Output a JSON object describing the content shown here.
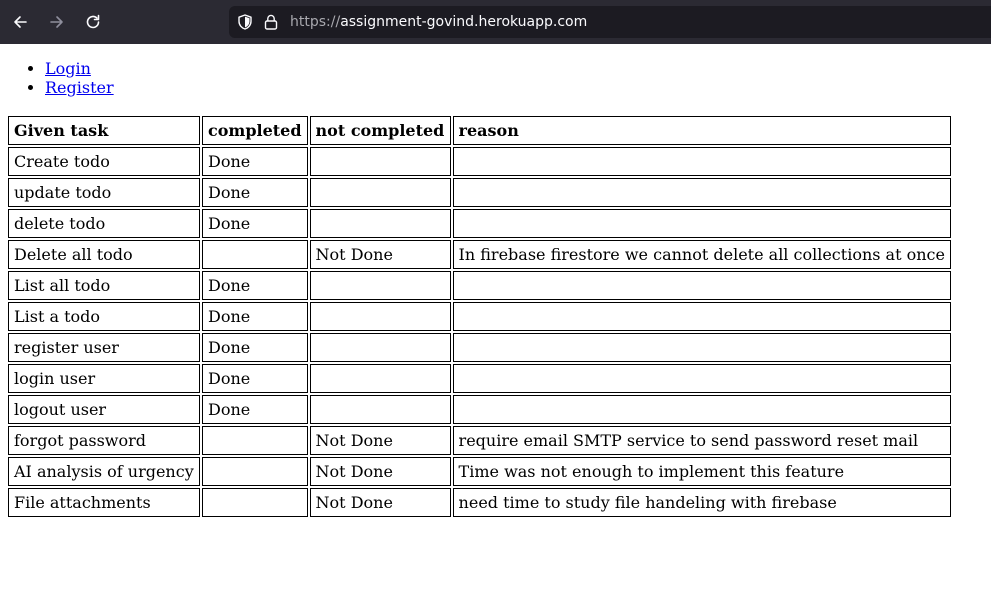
{
  "browser": {
    "url_scheme": "https://",
    "url_host": "assignment-govind.herokuapp.com",
    "back_icon": "arrow-left-icon",
    "forward_icon": "arrow-right-icon",
    "reload_icon": "reload-icon",
    "shield_icon": "shield-icon",
    "lock_icon": "lock-icon"
  },
  "nav": {
    "items": [
      {
        "label": "Login"
      },
      {
        "label": "Register"
      }
    ]
  },
  "table": {
    "headers": [
      "Given task",
      "completed",
      "not completed",
      "reason"
    ],
    "rows": [
      {
        "task": "Create todo",
        "completed": "Done",
        "not_completed": "",
        "reason": ""
      },
      {
        "task": "update todo",
        "completed": "Done",
        "not_completed": "",
        "reason": ""
      },
      {
        "task": "delete todo",
        "completed": "Done",
        "not_completed": "",
        "reason": ""
      },
      {
        "task": "Delete all todo",
        "completed": "",
        "not_completed": "Not Done",
        "reason": "In firebase firestore we cannot delete all collections at once"
      },
      {
        "task": "List all todo",
        "completed": "Done",
        "not_completed": "",
        "reason": ""
      },
      {
        "task": "List a todo",
        "completed": "Done",
        "not_completed": "",
        "reason": ""
      },
      {
        "task": "register user",
        "completed": "Done",
        "not_completed": "",
        "reason": ""
      },
      {
        "task": "login user",
        "completed": "Done",
        "not_completed": "",
        "reason": ""
      },
      {
        "task": "logout user",
        "completed": "Done",
        "not_completed": "",
        "reason": ""
      },
      {
        "task": "forgot password",
        "completed": "",
        "not_completed": "Not Done",
        "reason": "require email SMTP service to send password reset mail"
      },
      {
        "task": "AI analysis of urgency",
        "completed": "",
        "not_completed": "Not Done",
        "reason": "Time was not enough to implement this feature"
      },
      {
        "task": "File attachments",
        "completed": "",
        "not_completed": "Not Done",
        "reason": "need time to study file handeling with firebase"
      }
    ]
  }
}
